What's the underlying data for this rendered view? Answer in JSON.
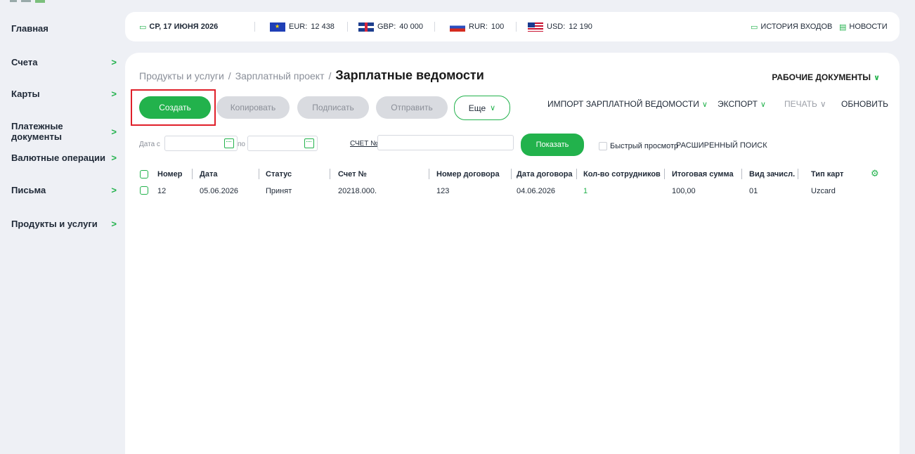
{
  "sidebar": {
    "items": [
      {
        "label": "Главная",
        "has_arrow": false
      },
      {
        "label": "Счета",
        "has_arrow": true
      },
      {
        "label": "Карты",
        "has_arrow": true
      },
      {
        "label": "Платежные документы",
        "has_arrow": true
      },
      {
        "label": "Валютные операции",
        "has_arrow": true
      },
      {
        "label": "Письма",
        "has_arrow": true
      },
      {
        "label": "Продукты и услуги",
        "has_arrow": true
      }
    ],
    "arrow": ">"
  },
  "topbar": {
    "date": "СР, 17 ИЮНЯ 2026",
    "rates": [
      {
        "code": "EUR:",
        "value": "12 438",
        "flag": "eu-flag-icon"
      },
      {
        "code": "GBP:",
        "value": "40 000",
        "flag": "gb-flag-icon"
      },
      {
        "code": "RUR:",
        "value": "100",
        "flag": "ru-flag-icon"
      },
      {
        "code": "USD:",
        "value": "12 190",
        "flag": "us-flag-icon"
      }
    ],
    "login_history": "ИСТОРИЯ ВХОДОВ",
    "news": "НОВОСТИ"
  },
  "main": {
    "breadcrumb": [
      "Продукты и услуги",
      "Зарплатный проект",
      "Зарплатные ведомости"
    ],
    "breadcrumb_sep": "/",
    "work_docs": "РАБОЧИЕ ДОКУМЕНТЫ",
    "buttons": {
      "create": "Создать",
      "copy": "Копировать",
      "sign": "Подписать",
      "send": "Отправить",
      "more": "Еще"
    },
    "actions": {
      "import": "ИМПОРТ ЗАРПЛАТНОЙ ВЕДОМОСТИ",
      "export": "ЭКСПОРТ",
      "print": "ПЕЧАТЬ",
      "refresh": "ОБНОВИТЬ"
    },
    "filters": {
      "date_from_label": "Дата с",
      "date_to_label": "по",
      "account_label": "СЧЕТ №",
      "show": "Показать",
      "quick_view": "Быстрый просмотр",
      "advanced_search": "РАСШИРЕННЫЙ ПОИСК"
    },
    "table": {
      "columns": [
        "Номер",
        "Дата",
        "Статус",
        "Счет №",
        "Номер договора",
        "Дата договора",
        "Кол-во сотрудников",
        "Итоговая сумма",
        "Вид зачисл.",
        "Тип карт"
      ],
      "rows": [
        [
          "12",
          "05.06.2026",
          "Принят",
          "20218.000.",
          "123",
          "04.06.2026",
          "1",
          "100,00",
          "01",
          "Uzcard"
        ]
      ]
    }
  },
  "colors": {
    "accent": "#22b24c",
    "highlight": "#e0202a",
    "background": "#eef0f5"
  }
}
